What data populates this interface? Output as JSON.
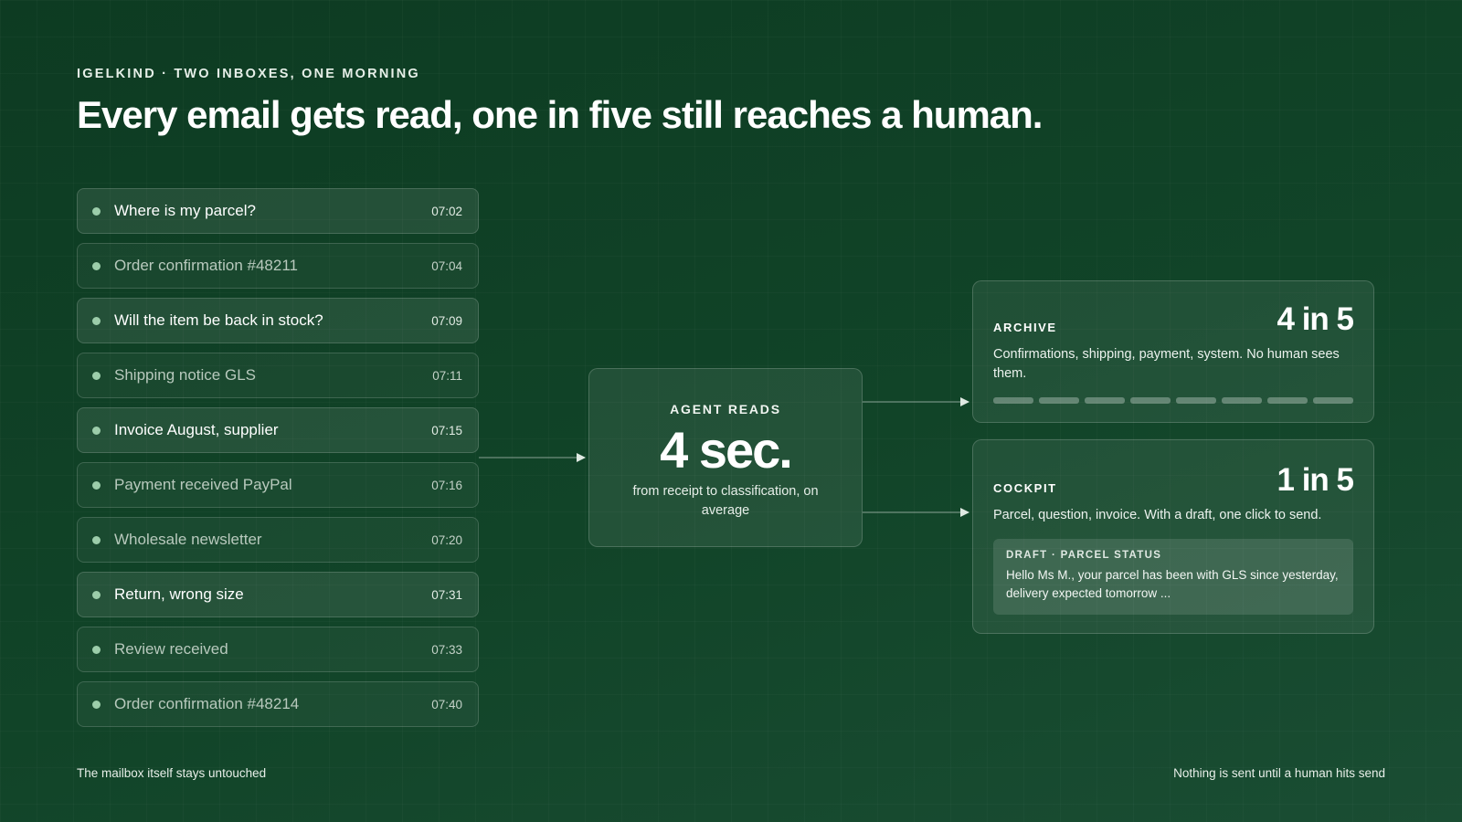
{
  "header": {
    "eyebrow": "IGELKIND · TWO INBOXES, ONE MORNING",
    "title": "Every email gets read, one in five still reaches a human."
  },
  "inbox": {
    "emails": [
      {
        "subject": "Where is my parcel?",
        "time": "07:02",
        "route": "human"
      },
      {
        "subject": "Order confirmation #48211",
        "time": "07:04",
        "route": "auto"
      },
      {
        "subject": "Will the item be back in stock?",
        "time": "07:09",
        "route": "human"
      },
      {
        "subject": "Shipping notice GLS",
        "time": "07:11",
        "route": "auto"
      },
      {
        "subject": "Invoice August, supplier",
        "time": "07:15",
        "route": "human"
      },
      {
        "subject": "Payment received PayPal",
        "time": "07:16",
        "route": "auto"
      },
      {
        "subject": "Wholesale newsletter",
        "time": "07:20",
        "route": "auto"
      },
      {
        "subject": "Return, wrong size",
        "time": "07:31",
        "route": "human"
      },
      {
        "subject": "Review received",
        "time": "07:33",
        "route": "auto"
      },
      {
        "subject": "Order confirmation #48214",
        "time": "07:40",
        "route": "auto"
      }
    ]
  },
  "agent": {
    "label": "AGENT READS",
    "value": "4 sec.",
    "caption": "from receipt to classification, on average"
  },
  "archive": {
    "title": "ARCHIVE",
    "ratio": "4 in 5",
    "description": "Confirmations, shipping, payment, system. No human sees them.",
    "bar_count": 8
  },
  "cockpit": {
    "title": "COCKPIT",
    "ratio": "1 in 5",
    "description": "Parcel, question, invoice. With a draft, one click to send.",
    "draft_label": "DRAFT · PARCEL STATUS",
    "draft_text": "Hello Ms M., your parcel has been with GLS since yesterday, delivery expected tomorrow ..."
  },
  "footer": {
    "left": "The mailbox itself stays untouched",
    "right": "Nothing is sent until a human hits send"
  },
  "colors": {
    "background": "#114428",
    "dot": "#9ccdaa",
    "text": "#ffffff"
  }
}
